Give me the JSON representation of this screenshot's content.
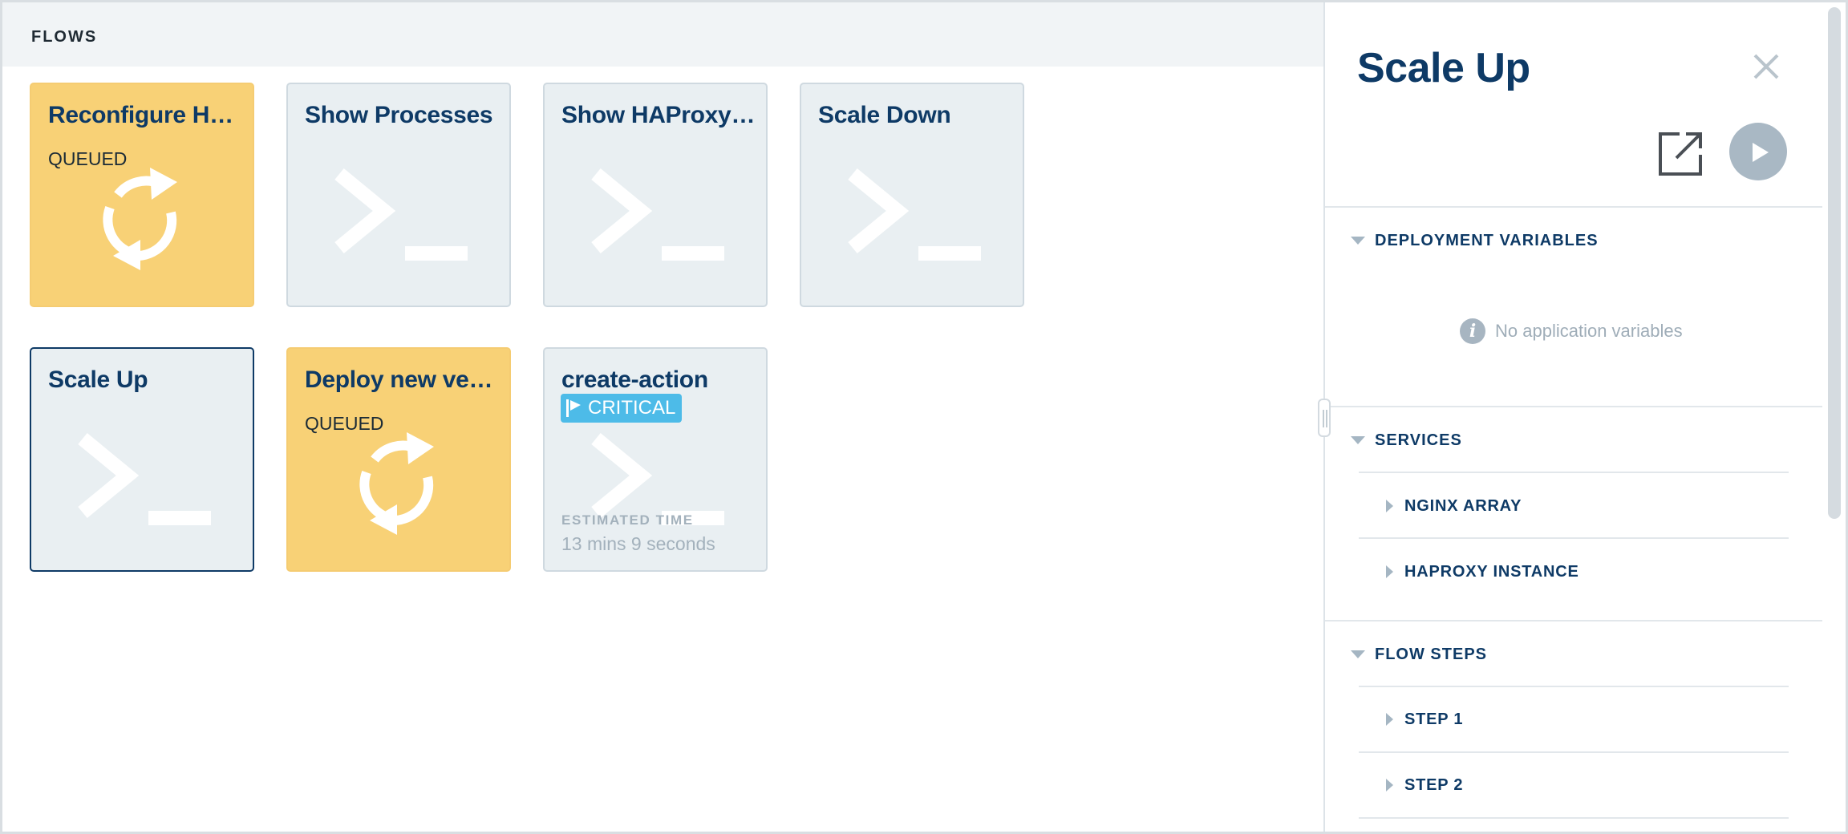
{
  "flows": {
    "header": "FLOWS",
    "cards": [
      {
        "title": "Reconfigure HAProxy",
        "status": "QUEUED",
        "state": "queued",
        "icon": "refresh-icon"
      },
      {
        "title": "Show Processes",
        "state": "idle",
        "icon": "terminal-icon"
      },
      {
        "title": "Show HAProxy Config",
        "state": "idle",
        "icon": "terminal-icon"
      },
      {
        "title": "Scale Down",
        "state": "idle",
        "icon": "terminal-icon"
      },
      {
        "title": "Scale Up",
        "state": "selected",
        "icon": "terminal-icon"
      },
      {
        "title": "Deploy new version",
        "status": "QUEUED",
        "state": "queued",
        "icon": "refresh-icon"
      },
      {
        "title": "create-action",
        "state": "idle",
        "icon": "terminal-icon",
        "badge": "CRITICAL",
        "estimate_label": "ESTIMATED TIME",
        "estimate_value": "13 mins 9 seconds"
      }
    ]
  },
  "panel": {
    "title": "Scale Up",
    "deployment_variables": {
      "label": "DEPLOYMENT VARIABLES",
      "empty_text": "No application variables"
    },
    "services": {
      "label": "SERVICES",
      "items": [
        "NGINX ARRAY",
        "HAPROXY INSTANCE"
      ]
    },
    "flow_steps": {
      "label": "FLOW STEPS",
      "items": [
        "STEP 1",
        "STEP 2"
      ]
    }
  },
  "colors": {
    "queued": "#f8d176",
    "idle": "#e9eff2",
    "navy": "#0e3a66",
    "critical": "#4dbbe8"
  }
}
